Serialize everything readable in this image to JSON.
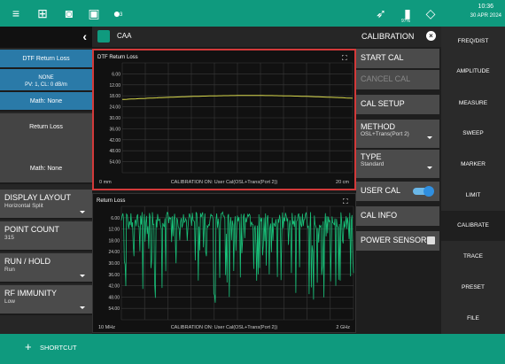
{
  "status": {
    "notif_count": "3",
    "battery": "97%",
    "time": "10:36",
    "date": "30 APR 2024"
  },
  "instrument": {
    "title": "CAA"
  },
  "left": {
    "dtf_return_loss": "DTF Return Loss",
    "none_label": "NONE",
    "pv_label": "PV: 1, CL: 0 dB/m",
    "math1": "Math: None",
    "return_loss": "Return Loss",
    "math2": "Math: None",
    "display_layout": "DISPLAY LAYOUT",
    "display_layout_value": "Horizontal Split",
    "point_count": "POINT COUNT",
    "point_count_value": "315",
    "run_hold": "RUN / HOLD",
    "run_hold_value": "Run",
    "rf_immunity": "RF IMMUNITY",
    "rf_immunity_value": "Low"
  },
  "plot1": {
    "title": "DTF Return Loss",
    "yticks": [
      "6.00",
      "12.00",
      "18.00",
      "24.00",
      "30.00",
      "36.00",
      "42.00",
      "48.00",
      "54.00"
    ],
    "x_start": "0 mm",
    "x_end": "20 cm",
    "status": "CALIBRATION ON: User Cal(OSL+Trans(Port 2))"
  },
  "plot2": {
    "title": "Return Loss",
    "yticks": [
      "6.00",
      "12.00",
      "18.00",
      "24.00",
      "30.00",
      "36.00",
      "42.00",
      "48.00",
      "54.00"
    ],
    "x_start": "10 MHz",
    "x_end": "2 GHz",
    "status": "CALIBRATION ON: User Cal(OSL+Trans(Port 2))"
  },
  "cal": {
    "header": "CALIBRATION",
    "start_cal": "START CAL",
    "cancel_cal": "CANCEL CAL",
    "cal_setup": "CAL SETUP",
    "method": "METHOD",
    "method_value": "OSL+Trans(Port 2)",
    "type": "TYPE",
    "type_value": "Standard",
    "user_cal": "USER CAL",
    "cal_info": "CAL INFO",
    "power_sensor": "POWER SENSOR"
  },
  "nav": [
    "FREQ/DIST",
    "AMPLITUDE",
    "MEASURE",
    "SWEEP",
    "MARKER",
    "LIMIT",
    "CALIBRATE",
    "TRACE",
    "PRESET",
    "FILE"
  ],
  "bottom": {
    "shortcut": "SHORTCUT"
  },
  "colors": {
    "accent": "#0f9a7e",
    "trace1": "#d7d84a",
    "trace2": "#19c27a",
    "highlight": "#d33a3a"
  }
}
